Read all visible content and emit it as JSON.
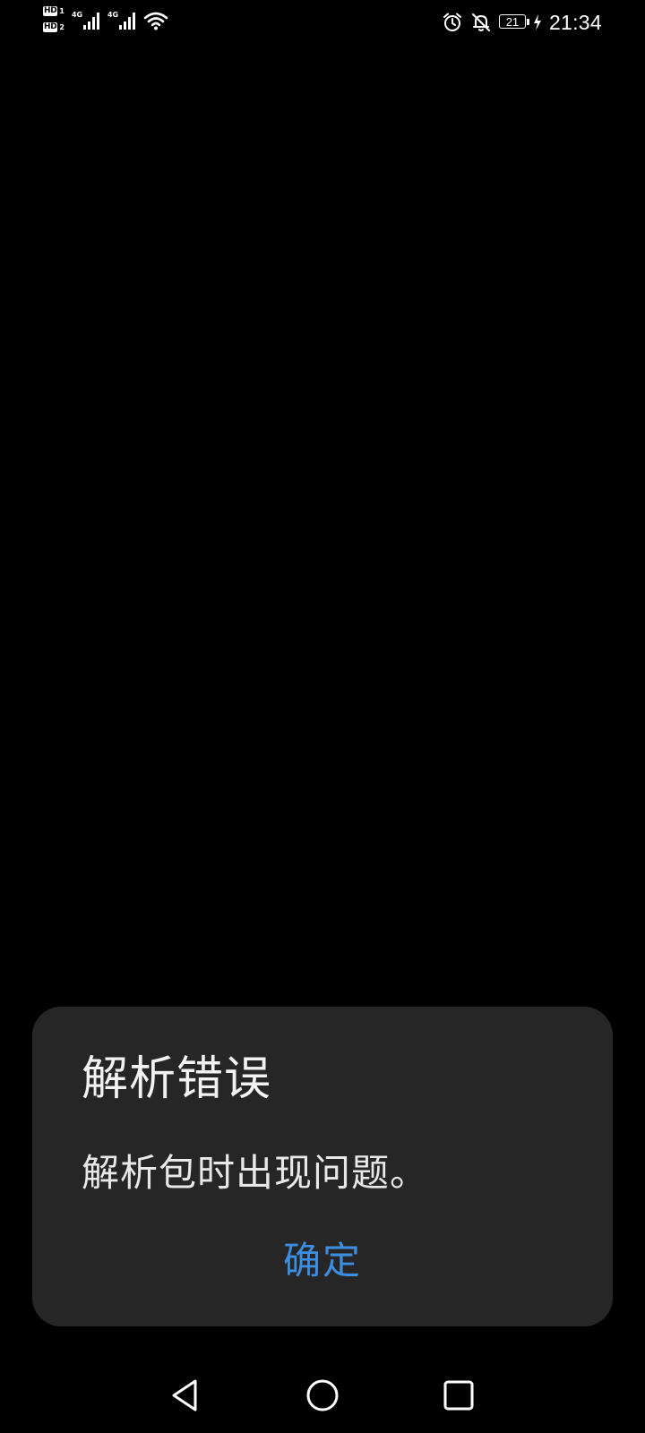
{
  "status_bar": {
    "sim1_label": "HD",
    "sim1_number": "1",
    "sim2_label": "HD",
    "sim2_number": "2",
    "signal1_tech": "4G",
    "signal2_tech": "4G",
    "battery_level": "21",
    "time": "21:34",
    "icons": [
      "hd-icon",
      "signal-icon",
      "wifi-icon",
      "alarm-icon",
      "bell-off-icon",
      "battery-icon",
      "charging-icon"
    ]
  },
  "dialog": {
    "title": "解析错误",
    "message": "解析包时出现问题。",
    "ok_label": "确定",
    "background": "#262626",
    "accent": "#3d8ee0"
  },
  "nav_bar": {
    "icons": [
      "back-icon",
      "home-icon",
      "recents-icon"
    ]
  }
}
